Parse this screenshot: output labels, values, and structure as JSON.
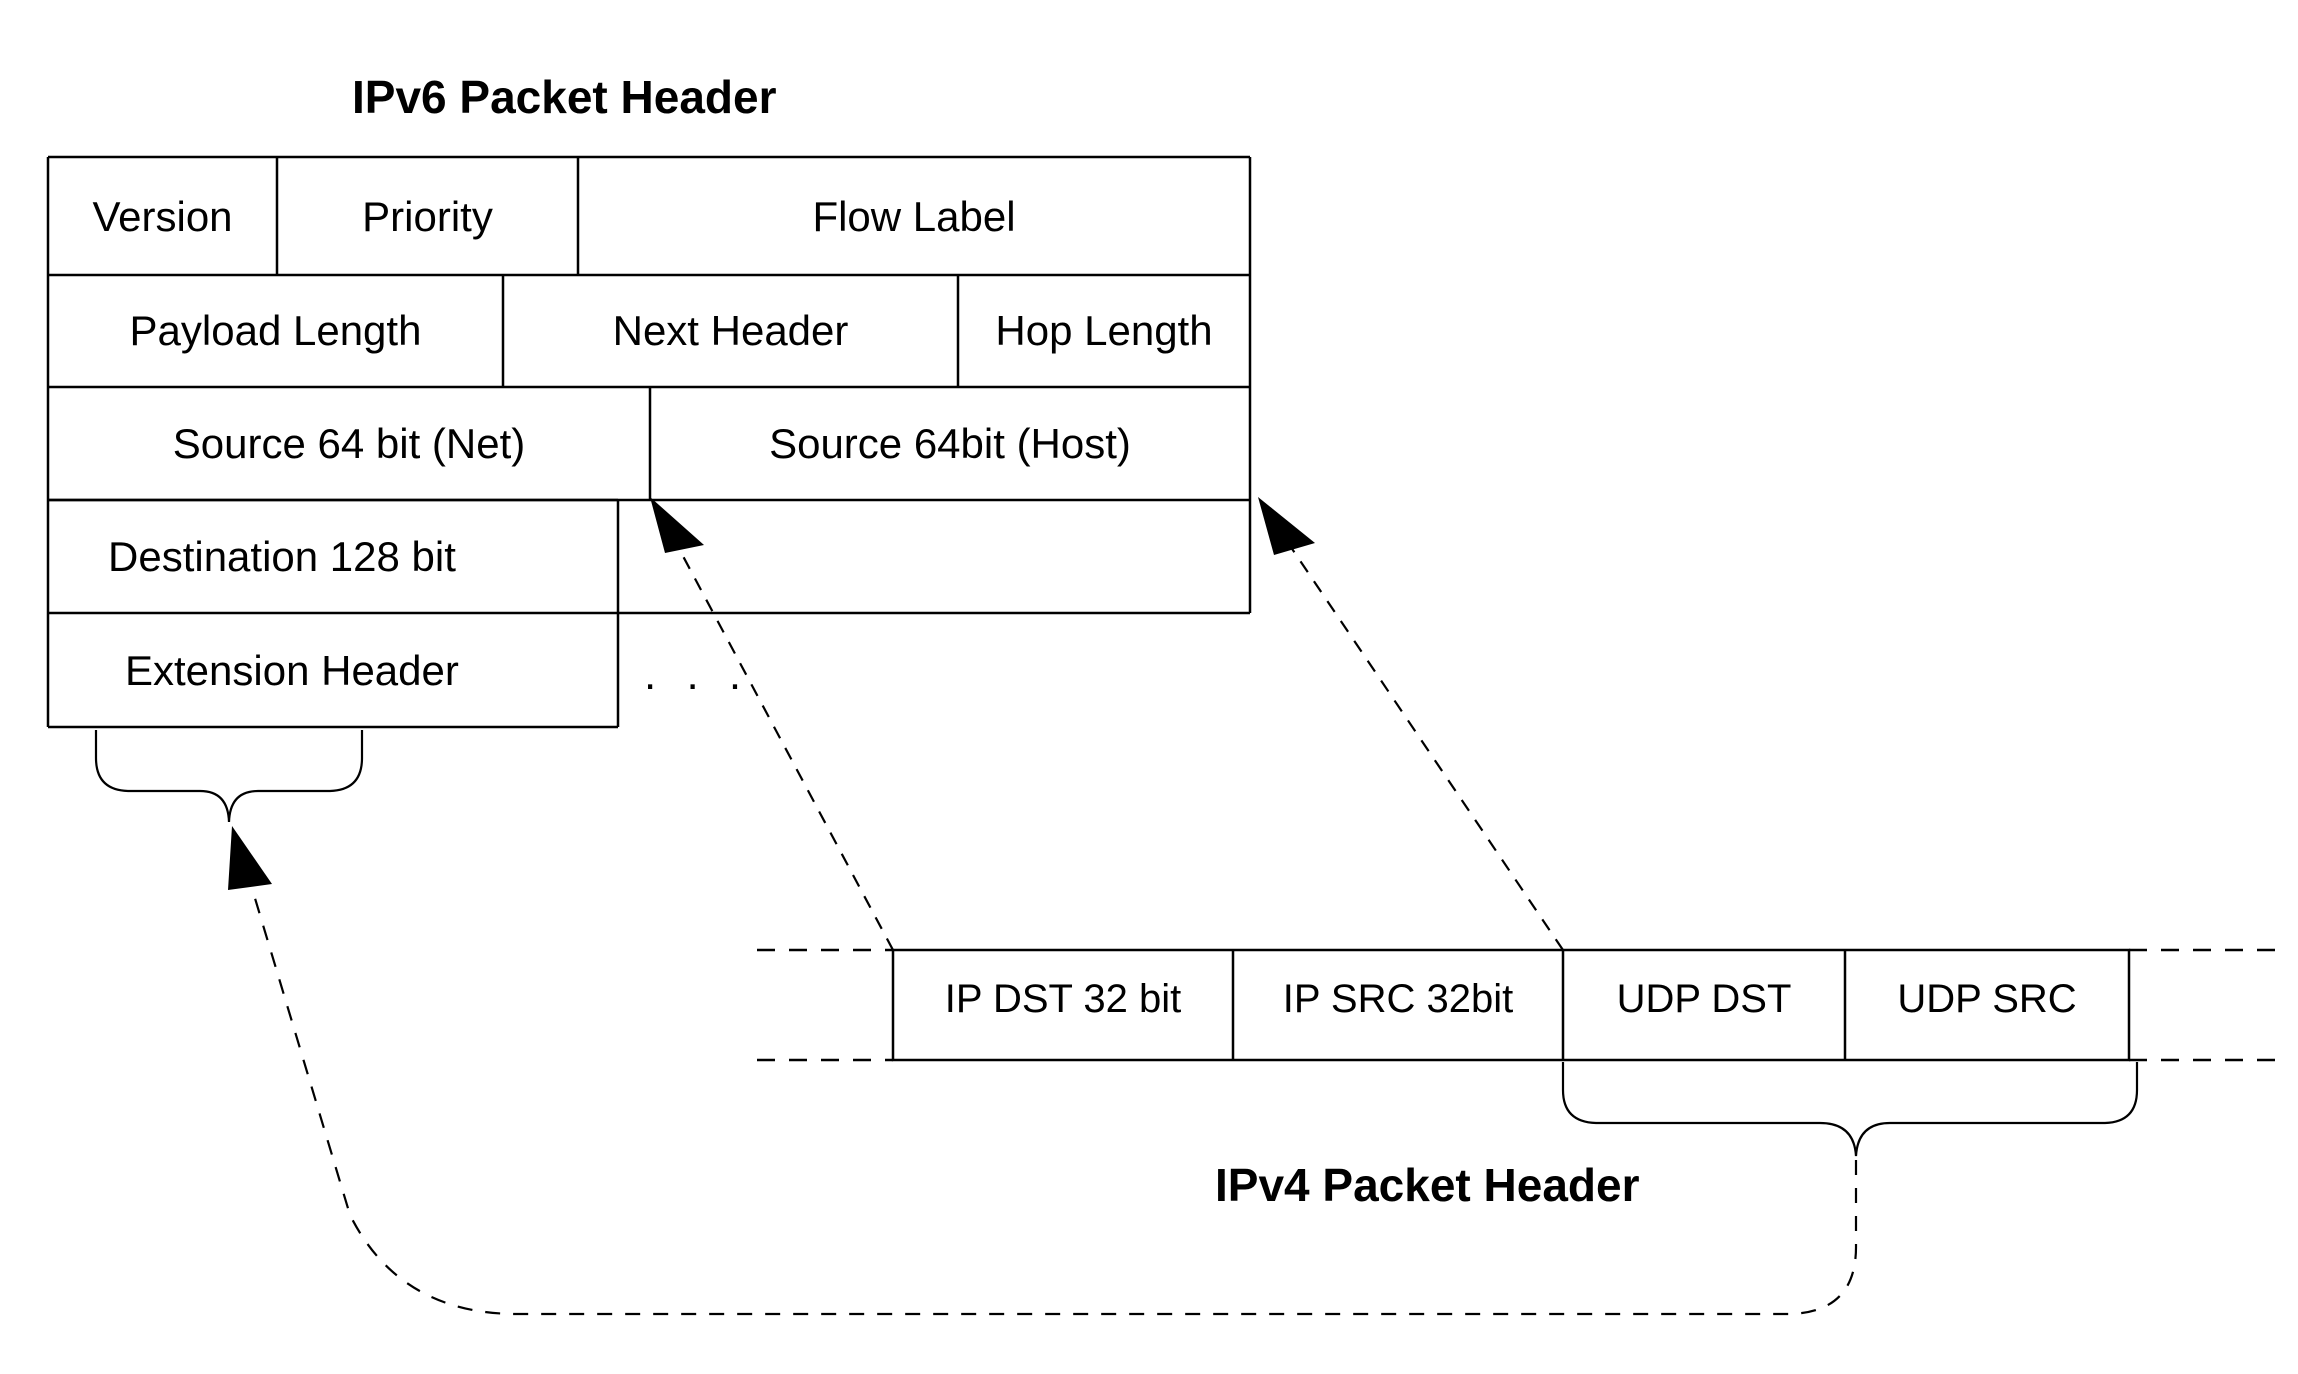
{
  "diagram": {
    "ipv6": {
      "title": "IPv6 Packet Header",
      "rows": [
        {
          "cells": [
            {
              "label": "Version"
            },
            {
              "label": "Priority"
            },
            {
              "label": "Flow Label"
            }
          ]
        },
        {
          "cells": [
            {
              "label": "Payload Length"
            },
            {
              "label": "Next Header"
            },
            {
              "label": "Hop Length"
            }
          ]
        },
        {
          "cells": [
            {
              "label": "Source 64 bit (Net)"
            },
            {
              "label": "Source 64bit (Host)"
            }
          ]
        },
        {
          "cells": [
            {
              "label": "Destination 128 bit"
            }
          ]
        },
        {
          "cells": [
            {
              "label": "Extension Header"
            }
          ]
        }
      ],
      "continuation": ". . ."
    },
    "ipv4": {
      "title": "IPv4 Packet Header",
      "cells": [
        {
          "label": "IP DST 32 bit"
        },
        {
          "label": "IP SRC 32bit"
        },
        {
          "label": "UDP DST"
        },
        {
          "label": "UDP SRC"
        }
      ]
    },
    "colors": {
      "stroke": "#000000",
      "background": "#ffffff",
      "text": "#000000"
    }
  }
}
